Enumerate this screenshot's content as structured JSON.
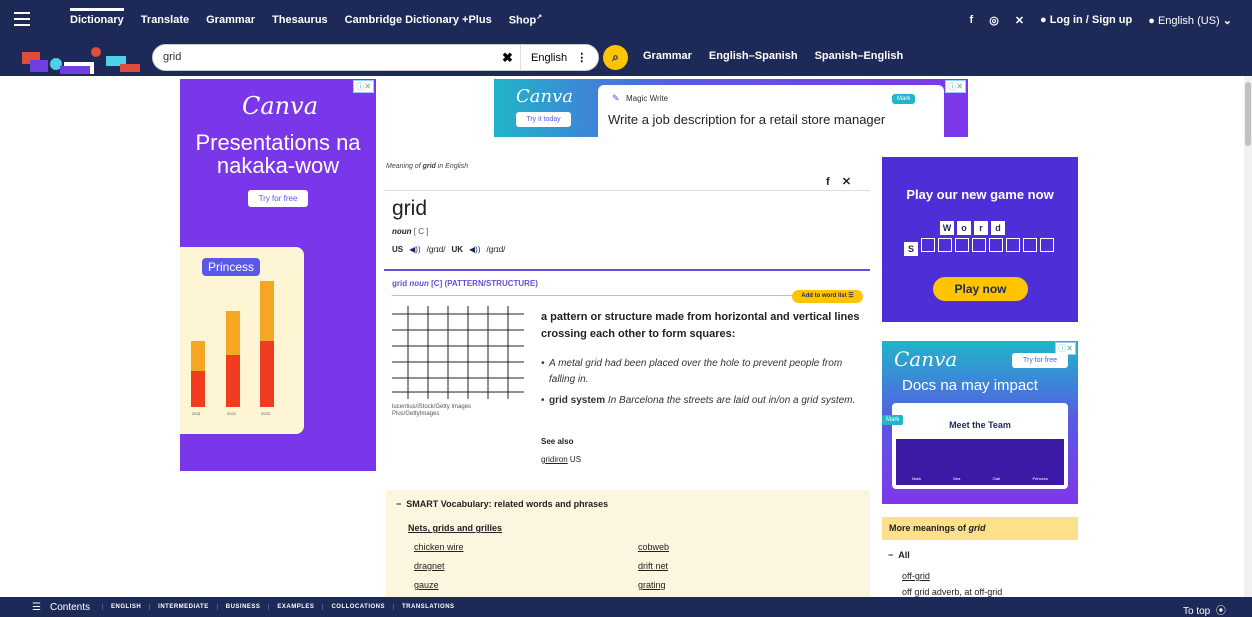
{
  "nav": {
    "links": [
      "Dictionary",
      "Translate",
      "Grammar",
      "Thesaurus",
      "Cambridge Dictionary +Plus",
      "Shop"
    ],
    "login": "Log in / Sign up",
    "language": "English (US)"
  },
  "search": {
    "value": "grid",
    "lang": "English",
    "links": [
      "Grammar",
      "English–Spanish",
      "Spanish–English"
    ]
  },
  "ads": {
    "left": {
      "brand": "Canva",
      "headline": "Presentations na nakaka-wow",
      "cta": "Try for free",
      "tag": "Princess",
      "years": [
        "2021",
        "2022",
        "2023"
      ]
    },
    "top": {
      "brand": "Canva",
      "cta": "Try it today",
      "tool": "Magic Write",
      "badge": "Mark",
      "text": "Write a job description for a retail store manager"
    },
    "game": {
      "title": "Play our new game now",
      "word": [
        "W",
        "o",
        "r",
        "d"
      ],
      "start": "S",
      "cta": "Play now"
    },
    "docs": {
      "brand": "Canva",
      "cta": "Try for free",
      "headline": "Docs na may impact",
      "card_title": "Meet the Team",
      "tag": "Mark",
      "people": [
        "Mark",
        "Bea",
        "Gab",
        "Princess"
      ]
    }
  },
  "entry": {
    "meaning_prefix": "Meaning of ",
    "meaning_word": "grid",
    "meaning_suffix": " in English",
    "headword": "grid",
    "pos": "noun",
    "grammar": "[ C ]",
    "us_label": "US",
    "us_ipa": "/grɪd/",
    "uk_label": "UK",
    "uk_ipa": "/grɪd/",
    "guide_word": "grid",
    "guide_pos": "noun",
    "guide_gram": "[C]",
    "guide_label": "(PATTERN/STRUCTURE)",
    "add_list": "Add to word list",
    "definition": "a pattern or structure made from horizontal and vertical lines crossing each other to form squares:",
    "example1": "A metal grid had been placed over the hole to prevent people from falling in.",
    "example2_term": "grid system",
    "example2": "In Barcelona the streets are laid out in/on a grid system.",
    "credit": "lucentius/iStock/Getty Images Plus/GettyImages",
    "see_also": "See also",
    "see_link": "gridiron",
    "see_region": "US"
  },
  "smart": {
    "heading": "SMART Vocabulary: related words and phrases",
    "subheading": "Nets, grids and grilles",
    "words_left": [
      "chicken wire",
      "dragnet",
      "gauze"
    ],
    "words_right": [
      "cobweb",
      "drift net",
      "grating"
    ]
  },
  "more": {
    "heading_prefix": "More meanings of ",
    "heading_word": "grid",
    "all": "All",
    "link1": "off-grid",
    "link2": "off grid adverb, at off-grid"
  },
  "bottom": {
    "contents": "Contents",
    "tabs": [
      "ENGLISH",
      "INTERMEDIATE",
      "BUSINESS",
      "EXAMPLES",
      "COLLOCATIONS",
      "TRANSLATIONS"
    ],
    "to_top": "To top"
  }
}
